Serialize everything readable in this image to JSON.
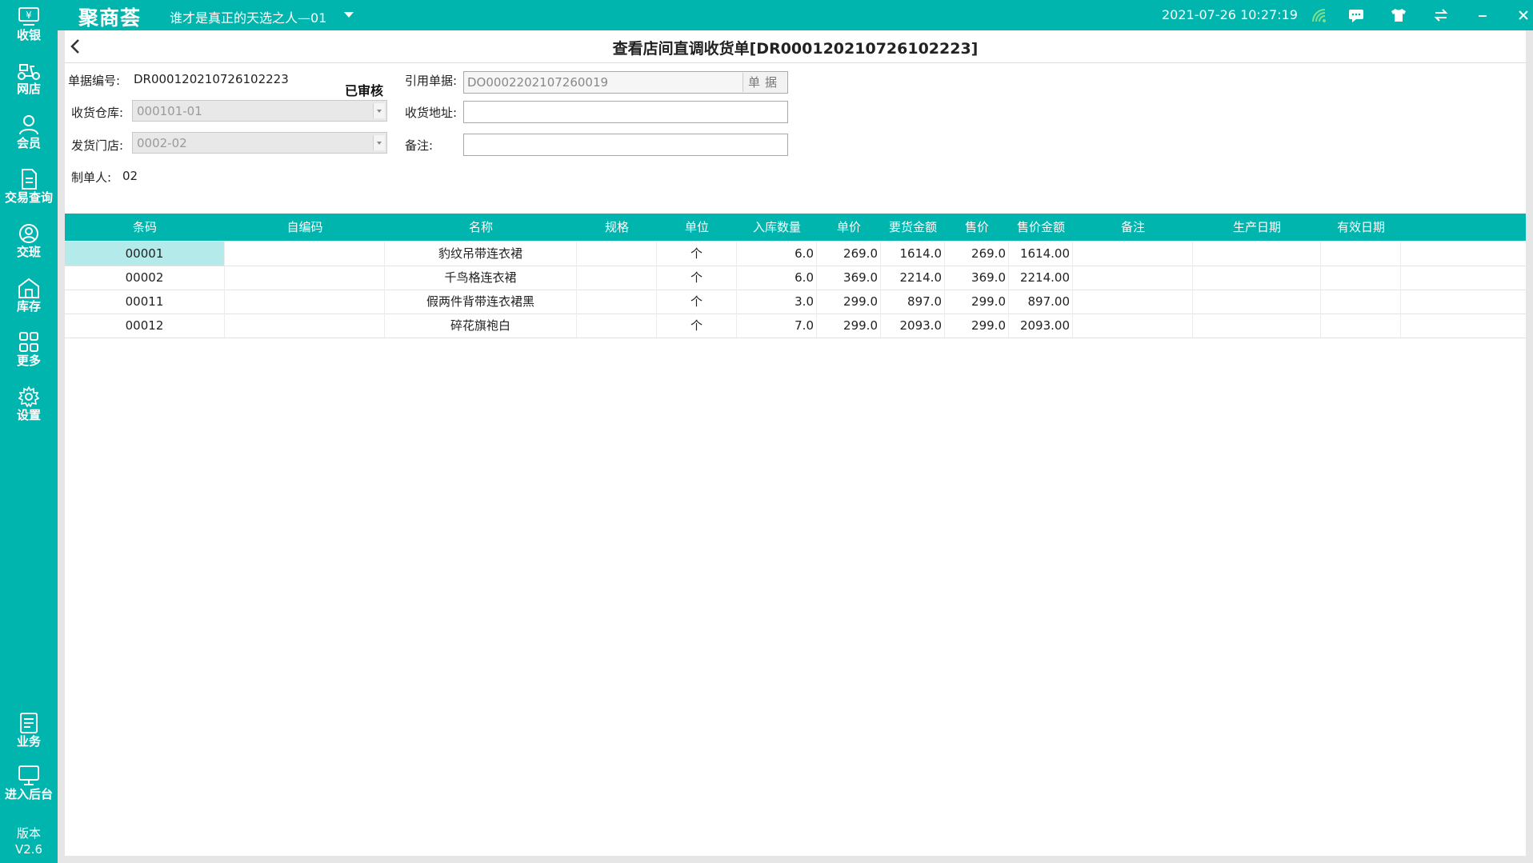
{
  "app": {
    "logo": "聚商荟",
    "store": "谁才是真正的天选之人—01",
    "datetime": "2021-07-26 10:27:19"
  },
  "sidebar": {
    "items": [
      {
        "label": "收银",
        "icon": "cash-register-icon"
      },
      {
        "label": "网店",
        "icon": "scooter-icon"
      },
      {
        "label": "会员",
        "icon": "user-icon"
      },
      {
        "label": "交易查询",
        "icon": "document-icon"
      },
      {
        "label": "交班",
        "icon": "shift-icon"
      },
      {
        "label": "库存",
        "icon": "warehouse-icon"
      },
      {
        "label": "更多",
        "icon": "grid-icon"
      },
      {
        "label": "设置",
        "icon": "gear-icon"
      }
    ],
    "bottom_items": [
      {
        "label": "业务",
        "icon": "business-icon"
      },
      {
        "label": "进入后台",
        "icon": "monitor-icon"
      }
    ],
    "version_label": "版本",
    "version": "V2.6"
  },
  "page": {
    "title": "查看店间直调收货单[DR000120210726102223]"
  },
  "form": {
    "doc_no_label": "单据编号:",
    "doc_no": "DR000120210726102223",
    "status": "已审核",
    "ref_doc_label": "引用单据:",
    "ref_doc": "DO0002202107260019",
    "ref_doc_button": "单据",
    "warehouse_label": "收货仓库:",
    "warehouse": "000101-01",
    "address_label": "收货地址:",
    "address": "",
    "store_label": "发货门店:",
    "store": "0002-02",
    "remark_label": "备注:",
    "remark": "",
    "creator_label": "制单人:",
    "creator": "02"
  },
  "table": {
    "columns": [
      "条码",
      "自编码",
      "名称",
      "规格",
      "单位",
      "入库数量",
      "单价",
      "要货金额",
      "售价",
      "售价金额",
      "备注",
      "生产日期",
      "有效日期"
    ],
    "rows": [
      {
        "barcode": "00001",
        "code": "",
        "name": "豹纹吊带连衣裙",
        "spec": "",
        "unit": "个",
        "qty": "6.0",
        "price": "269.0",
        "order_amount": "1614.0",
        "sale_price": "269.0",
        "sale_amount": "1614.00",
        "remark": "",
        "prod_date": "",
        "exp_date": ""
      },
      {
        "barcode": "00002",
        "code": "",
        "name": "千鸟格连衣裙",
        "spec": "",
        "unit": "个",
        "qty": "6.0",
        "price": "369.0",
        "order_amount": "2214.0",
        "sale_price": "369.0",
        "sale_amount": "2214.00",
        "remark": "",
        "prod_date": "",
        "exp_date": ""
      },
      {
        "barcode": "00011",
        "code": "",
        "name": "假两件背带连衣裙黑",
        "spec": "",
        "unit": "个",
        "qty": "3.0",
        "price": "299.0",
        "order_amount": "897.0",
        "sale_price": "299.0",
        "sale_amount": "897.00",
        "remark": "",
        "prod_date": "",
        "exp_date": ""
      },
      {
        "barcode": "00012",
        "code": "",
        "name": "碎花旗袍白",
        "spec": "",
        "unit": "个",
        "qty": "7.0",
        "price": "299.0",
        "order_amount": "2093.0",
        "sale_price": "299.0",
        "sale_amount": "2093.00",
        "remark": "",
        "prod_date": "",
        "exp_date": ""
      }
    ]
  },
  "colors": {
    "brand": "#00b5ad",
    "row_highlight": "#b5eaea"
  }
}
